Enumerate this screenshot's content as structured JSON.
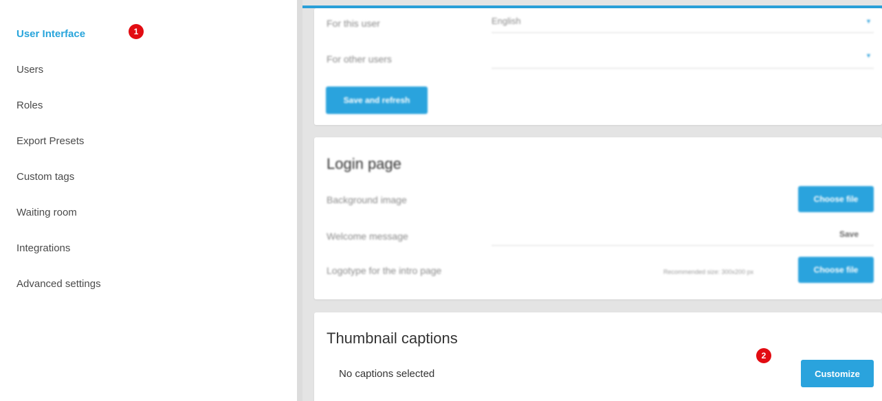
{
  "sidebar": {
    "items": [
      {
        "label": "User Interface"
      },
      {
        "label": "Users"
      },
      {
        "label": "Roles"
      },
      {
        "label": "Export Presets"
      },
      {
        "label": "Custom tags"
      },
      {
        "label": "Waiting room"
      },
      {
        "label": "Integrations"
      },
      {
        "label": "Advanced settings"
      }
    ],
    "annotation_badge": "1"
  },
  "language_card": {
    "for_this_user_label": "For this user",
    "for_this_user_value": "English",
    "for_other_users_label": "For other users",
    "for_other_users_value": "",
    "save_button": "Save and refresh"
  },
  "login_card": {
    "title": "Login page",
    "background_image_label": "Background image",
    "background_image_button": "Choose file",
    "welcome_message_label": "Welcome message",
    "welcome_save": "Save",
    "logotype_label": "Logotype for the intro page",
    "logotype_note": "Recommended size: 300x200 px",
    "logotype_button": "Choose file"
  },
  "captions_card": {
    "title": "Thumbnail captions",
    "status_text": "No captions selected",
    "customize_button": "Customize",
    "annotation_badge": "2"
  },
  "colors": {
    "accent": "#27a4db",
    "annotation": "#e20c12"
  }
}
